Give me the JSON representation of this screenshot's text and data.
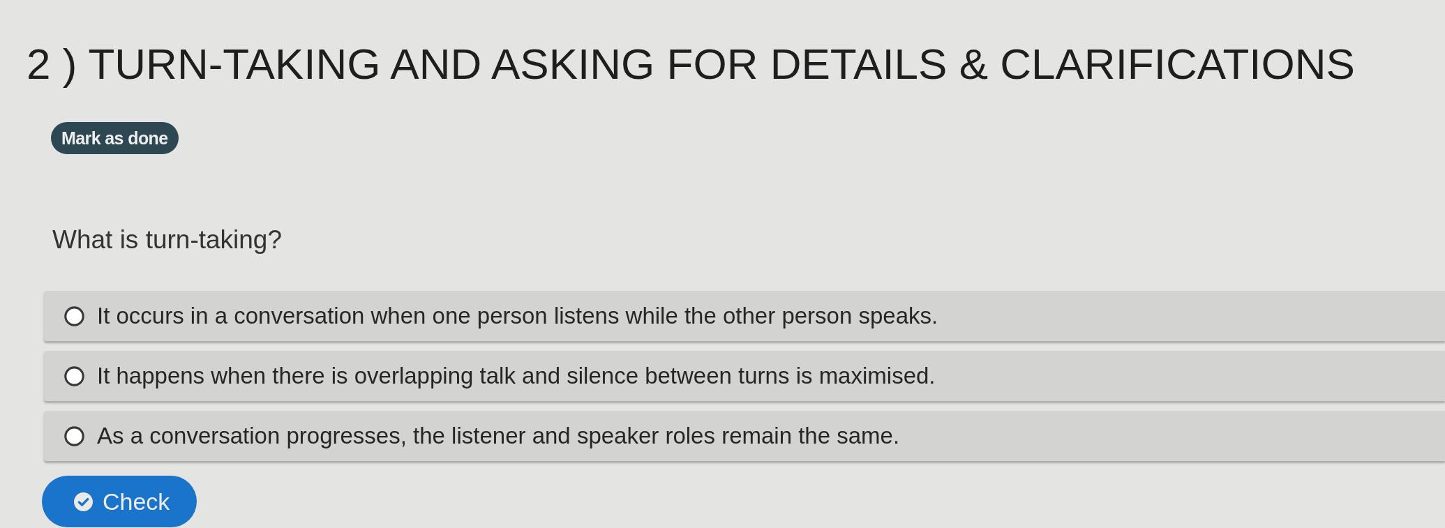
{
  "title": "2 ) TURN-TAKING AND ASKING FOR DETAILS & CLARIFICATIONS",
  "mark_done_button": {
    "label": "Mark as done"
  },
  "question": "What is turn-taking?",
  "options": [
    {
      "label": "It occurs in a conversation when one person listens while the other person speaks.",
      "selected": false
    },
    {
      "label": "It happens when there is overlapping talk and silence between turns is maximised.",
      "selected": false
    },
    {
      "label": "As a conversation progresses, the listener and speaker roles remain the same.",
      "selected": false
    }
  ],
  "check_button": {
    "label": "Check"
  }
}
